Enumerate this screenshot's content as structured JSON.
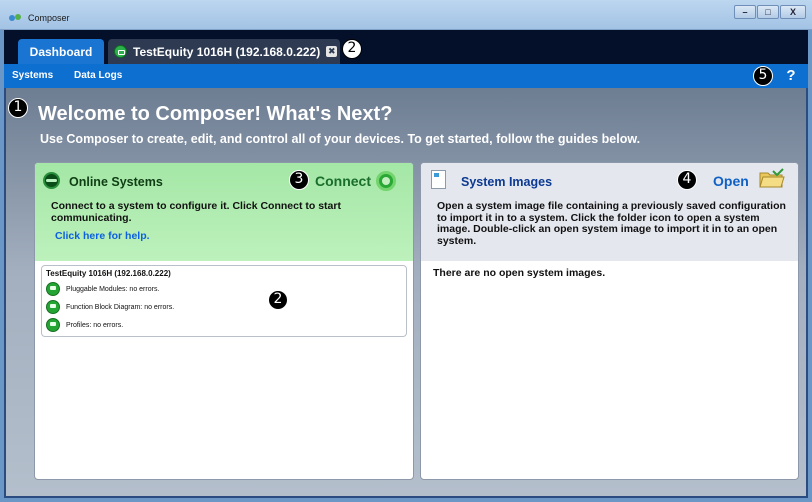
{
  "window": {
    "title": "Composer",
    "buttons": [
      "–",
      "□",
      "X"
    ]
  },
  "tabs": [
    {
      "label": "Dashboard",
      "active": true
    },
    {
      "label": "TestEquity 1016H (192.168.0.222)",
      "active": false,
      "close_glyph": "✖"
    }
  ],
  "markers": {
    "one": "1",
    "two": "2",
    "three": "3",
    "four": "4",
    "five": "5"
  },
  "subnav": {
    "systems": "Systems",
    "data_logs": "Data Logs",
    "help_glyph": "?"
  },
  "welcome": {
    "title": "Welcome to Composer! What's Next?",
    "subtitle": "Use Composer to create, edit, and control all of your devices. To get started, follow the guides below."
  },
  "online_systems": {
    "title": "Online Systems",
    "action": "Connect",
    "description": "Connect to a system to configure it. Click Connect to start communicating.",
    "help_link": "Click here for help.",
    "system": {
      "name": "TestEquity 1016H (192.168.0.222)",
      "statuses": [
        "Pluggable Modules: no errors.",
        "Function Block Diagram: no errors.",
        "Profiles: no errors."
      ]
    }
  },
  "system_images": {
    "title": "System Images",
    "action": "Open",
    "description": "Open a system image file containing a previously saved configuration to import it in to a system. Click the folder icon to open a system image. Double-click an open system image to import it in to an open system.",
    "empty_message": "There are no open system images."
  },
  "colors": {
    "tab_active": "#1a75d2",
    "subnav": "#0d6fd0",
    "online_header": "#a4e7a6",
    "link": "#0b5fe0"
  }
}
